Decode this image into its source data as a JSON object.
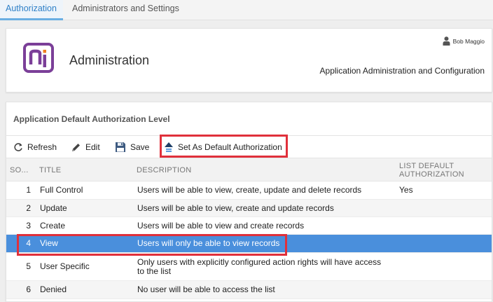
{
  "tabs": [
    {
      "label": "Authorization"
    },
    {
      "label": "Administrators and Settings"
    }
  ],
  "header": {
    "app_title": "Administration",
    "user_name": "Bob Maggio",
    "subtitle": "Application Administration and Configuration"
  },
  "section": {
    "title": "Application Default Authorization Level"
  },
  "toolbar": {
    "refresh": "Refresh",
    "edit": "Edit",
    "save": "Save",
    "set_default": "Set As Default Authorization"
  },
  "grid": {
    "columns": [
      "SO...",
      "TITLE",
      "DESCRIPTION",
      "LIST DEFAULT AUTHORIZATION"
    ],
    "rows": [
      {
        "sort": "1",
        "title": "Full Control",
        "description": "Users will be able to view, create, update and delete records",
        "list_default": "Yes"
      },
      {
        "sort": "2",
        "title": "Update",
        "description": "Users will be able to view, create and update records",
        "list_default": ""
      },
      {
        "sort": "3",
        "title": "Create",
        "description": "Users will be able to view and create records",
        "list_default": ""
      },
      {
        "sort": "4",
        "title": "View",
        "description": "Users will only be able to view records",
        "list_default": ""
      },
      {
        "sort": "5",
        "title": "User Specific",
        "description": "Only users with explicitly configured action rights will have access to the list",
        "list_default": ""
      },
      {
        "sort": "6",
        "title": "Denied",
        "description": "No user will be able to access the list",
        "list_default": ""
      }
    ]
  },
  "colors": {
    "accent": "#2f80c8",
    "selected_row": "#4a8fdc",
    "highlight": "#e0303b",
    "logo_purple": "#7b3f98",
    "logo_orange": "#f07f22"
  }
}
